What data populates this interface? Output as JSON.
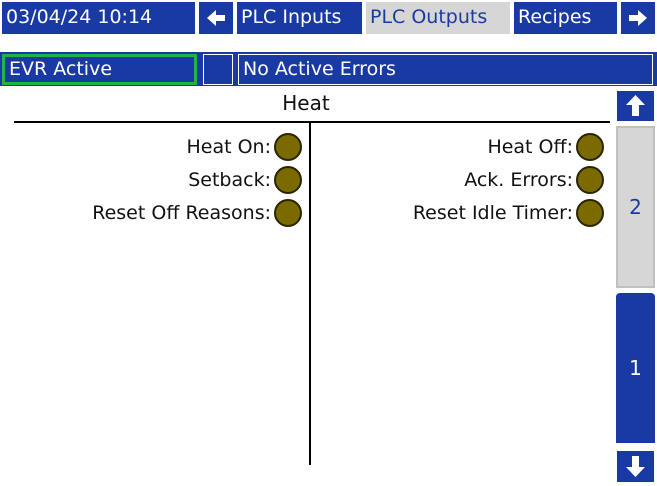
{
  "header": {
    "datetime": "03/04/24 10:14",
    "tabs": [
      {
        "label": "PLC Inputs",
        "active": false
      },
      {
        "label": "PLC Outputs",
        "active": true
      },
      {
        "label": "Recipes",
        "active": false
      }
    ],
    "status": "EVR Active",
    "errors": "No Active Errors"
  },
  "panel": {
    "title": "Heat",
    "left_column": [
      {
        "label": "Heat On:"
      },
      {
        "label": "Setback:"
      },
      {
        "label": "Reset Off Reasons:"
      }
    ],
    "right_column": [
      {
        "label": "Heat Off:"
      },
      {
        "label": "Ack. Errors:"
      },
      {
        "label": "Reset Idle Timer:"
      }
    ]
  },
  "pager": {
    "page_up": "2",
    "page_current": "1"
  },
  "colors": {
    "accent_blue": "#1a3aa3",
    "active_tab": "#d6d6d6",
    "status_border": "#22b24c",
    "indicator_off": "#7a6a00"
  }
}
